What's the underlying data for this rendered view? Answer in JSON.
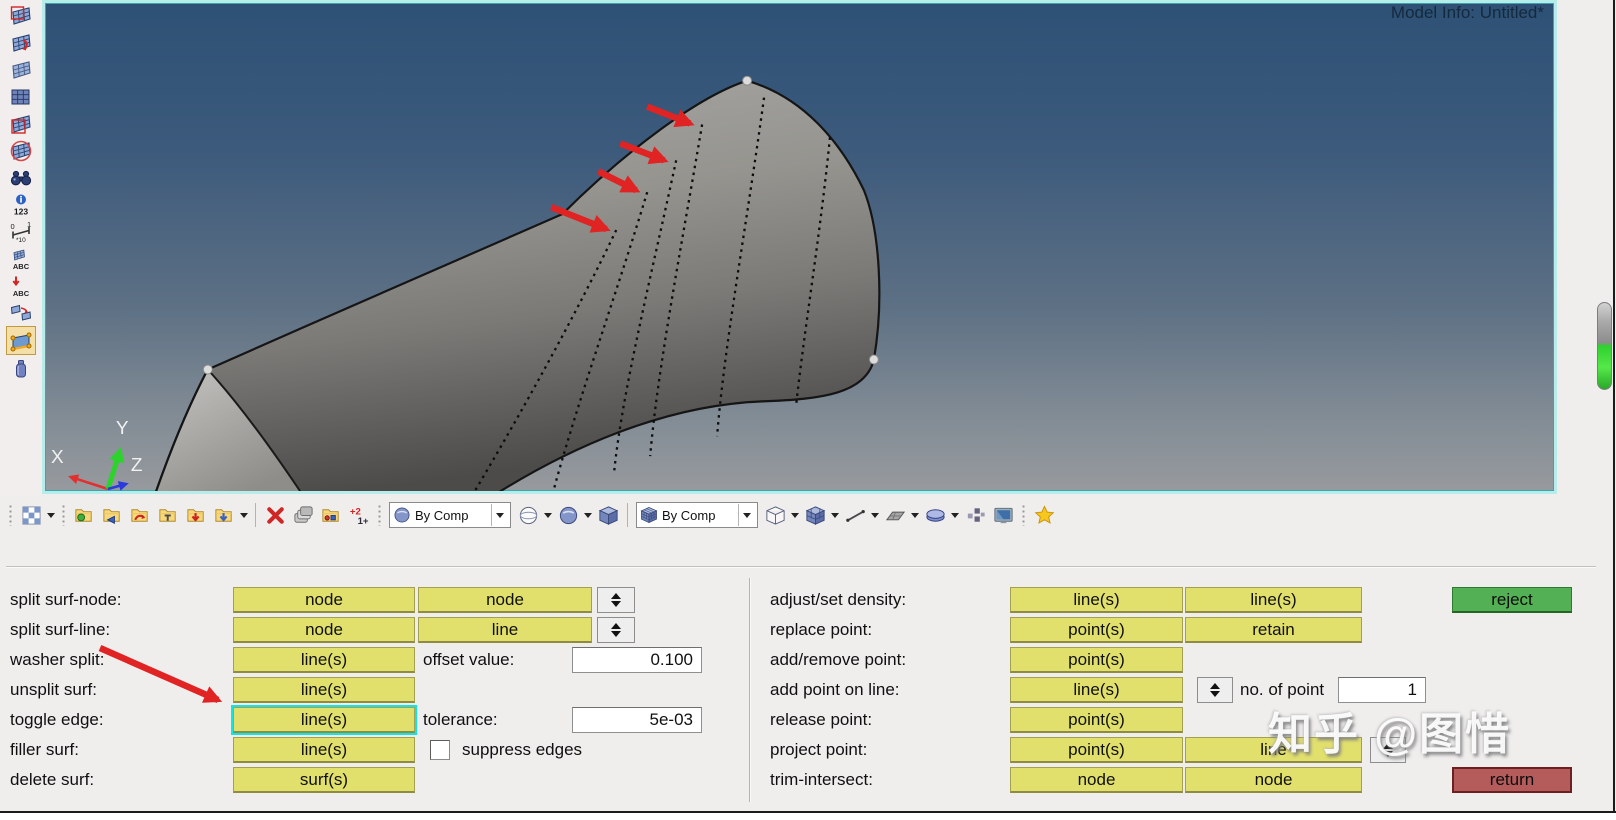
{
  "window": {
    "model_info": "Model Info: Untitled*"
  },
  "viewport": {
    "axis_x": "X",
    "axis_y": "Y",
    "axis_z": "Z"
  },
  "left_toolbar": {
    "icons": [
      "spline-surfaces",
      "surface-create",
      "skin-surface",
      "mesh-surface",
      "surface-edit-frame",
      "surface-circle",
      "find",
      "numbers",
      "measure",
      "label-grid",
      "label-arrow",
      "map-surfaces",
      "surface-edit",
      "solid-bottle"
    ],
    "active_icon": "surface-edit"
  },
  "bottom_toolbar": {
    "display_combo": {
      "label": "By Comp"
    },
    "component_combo": {
      "label": "By Comp"
    },
    "icons": [
      "selector-pattern",
      "open-model",
      "import",
      "export",
      "load",
      "save",
      "save-as",
      "delete",
      "components",
      "organize",
      "renumber",
      "wireframe-sphere",
      "shaded-sphere",
      "solid-cube",
      "wireframe-cube",
      "assembly-cube",
      "line-tool",
      "plane-tool",
      "disc-tool",
      "arrange-windows",
      "screen",
      "favorites-star"
    ]
  },
  "icon_glyphs": {
    "numbers": "123",
    "abc": "ABC",
    "measure_zero": "0",
    "measure_one": "1",
    "measure_mult": "*10",
    "renumber_top": "+2",
    "renumber_bottom": "1+"
  },
  "panel": {
    "left_rows": [
      {
        "label": "split surf-node:",
        "btn1": "node",
        "btn2": "node"
      },
      {
        "label": "split surf-line:",
        "btn1": "node",
        "btn2": "line"
      },
      {
        "label": "washer split:",
        "btn1": "line(s)",
        "field_label": "offset value:",
        "field_value": "0.100"
      },
      {
        "label": "unsplit surf:",
        "btn1": "line(s)"
      },
      {
        "label": "toggle edge:",
        "btn1": "line(s)",
        "field_label": "tolerance:",
        "field_value": "5e-03",
        "highlighted": true
      },
      {
        "label": "filler surf:",
        "btn1": "line(s)",
        "checkbox_label": "suppress edges",
        "checked": false
      },
      {
        "label": "delete surf:",
        "btn1": "surf(s)"
      }
    ],
    "right_rows": [
      {
        "label": "adjust/set density:",
        "btn1": "line(s)",
        "btn2": "line(s)"
      },
      {
        "label": "replace point:",
        "btn1": "point(s)",
        "btn2": "retain"
      },
      {
        "label": "add/remove point:",
        "btn1": "point(s)"
      },
      {
        "label": "add point on line:",
        "btn1": "line(s)",
        "field_label": "no. of point",
        "field_value": "1"
      },
      {
        "label": "release point:",
        "btn1": "point(s)"
      },
      {
        "label": "project point:",
        "btn1": "point(s)",
        "btn2": "line"
      },
      {
        "label": "trim-intersect:",
        "btn1": "node",
        "btn2": "node"
      }
    ],
    "reject": "reject",
    "return": "return"
  },
  "watermark": "知乎 @图惜",
  "colors": {
    "highlight_cyan": "#10e6e6",
    "button_yellow": "#e2e06d",
    "reject_green": "#54b054",
    "return_red": "#b45b5b",
    "arrow_red": "#e02323",
    "viewport_border": "#b6ecea",
    "slider_green": "#3bd23b"
  }
}
